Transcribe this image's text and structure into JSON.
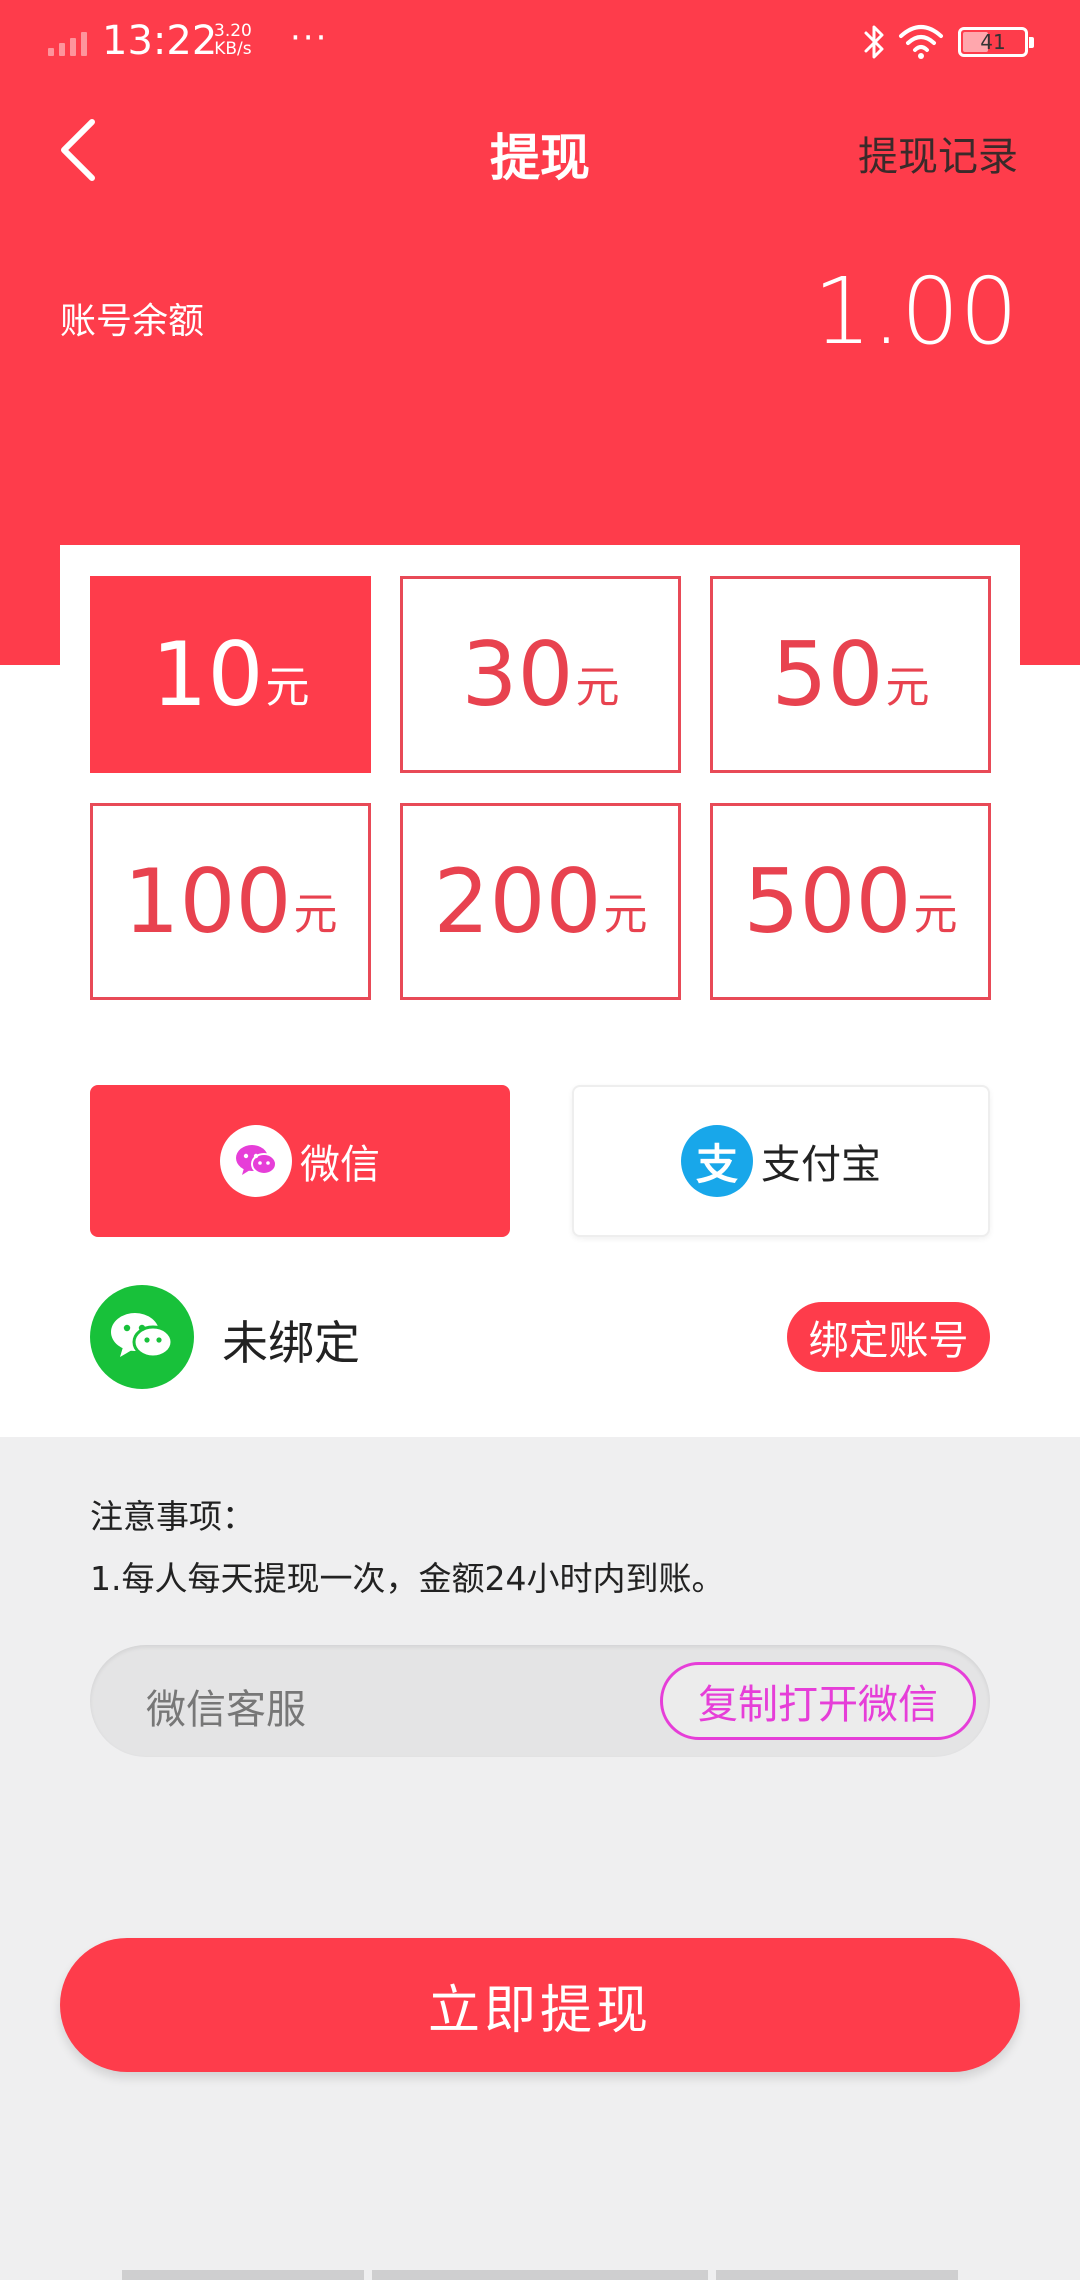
{
  "status_bar": {
    "time": "13:22",
    "speed_value": "3.20",
    "speed_unit": "KB/s",
    "more": "···",
    "battery": "41"
  },
  "nav": {
    "title": "提现",
    "record_link": "提现记录"
  },
  "balance": {
    "label": "账号余额",
    "value": "1.00"
  },
  "amounts": [
    {
      "num": "10",
      "unit": "元",
      "selected": true
    },
    {
      "num": "30",
      "unit": "元",
      "selected": false
    },
    {
      "num": "50",
      "unit": "元",
      "selected": false
    },
    {
      "num": "100",
      "unit": "元",
      "selected": false
    },
    {
      "num": "200",
      "unit": "元",
      "selected": false
    },
    {
      "num": "500",
      "unit": "元",
      "selected": false
    }
  ],
  "payment": {
    "wechat": {
      "label": "微信",
      "icon": "wechat-icon",
      "selected": true
    },
    "alipay": {
      "label": "支付宝",
      "icon_text": "支",
      "icon": "alipay-icon",
      "selected": false
    }
  },
  "binding": {
    "status": "未绑定",
    "button": "绑定账号"
  },
  "notice": {
    "title": "注意事项：",
    "items": [
      "1.每人每天提现一次，金额24小时内到账。"
    ]
  },
  "service": {
    "label": "微信客服",
    "copy_button": "复制打开微信"
  },
  "submit": {
    "label": "立即提现"
  },
  "colors": {
    "primary": "#fe3c4b",
    "wechat_green": "#18c13a",
    "alipay_blue": "#18a7ea",
    "magenta": "#e63ed8"
  }
}
